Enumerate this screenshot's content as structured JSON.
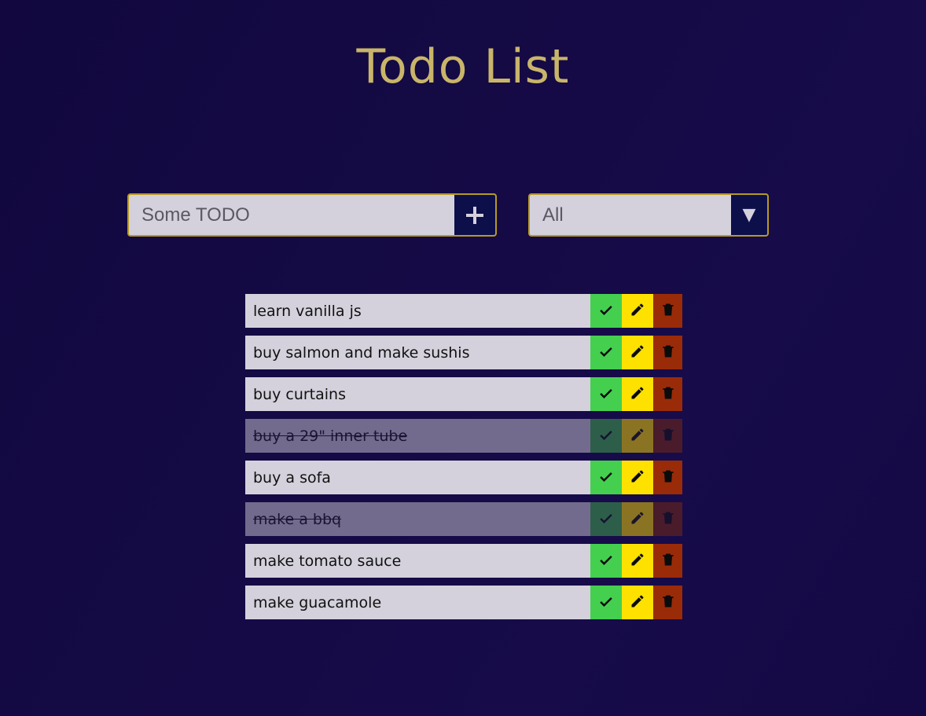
{
  "app": {
    "title": "Todo List"
  },
  "input": {
    "placeholder": "Some TODO",
    "add_icon": "plus-icon"
  },
  "filter": {
    "selected": "All",
    "arrow": "▼"
  },
  "todos": [
    {
      "text": "learn vanilla js",
      "done": false
    },
    {
      "text": "buy salmon and make sushis",
      "done": false
    },
    {
      "text": "buy curtains",
      "done": false
    },
    {
      "text": "buy a 29\" inner tube",
      "done": true
    },
    {
      "text": "buy a sofa",
      "done": false
    },
    {
      "text": "make a bbq",
      "done": true
    },
    {
      "text": "make tomato sauce",
      "done": false
    },
    {
      "text": "make guacamole",
      "done": false
    }
  ],
  "colors": {
    "background": "#150a45",
    "title": "#c9b56a",
    "border": "#b89a21",
    "check": "#44cf4f",
    "edit": "#ffe100",
    "delete": "#9a2b08"
  }
}
